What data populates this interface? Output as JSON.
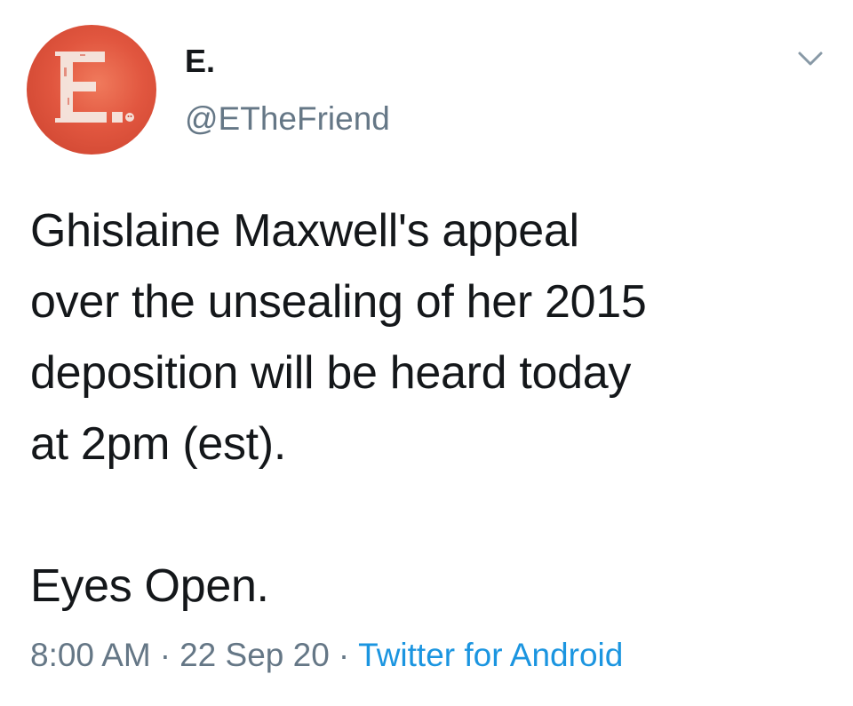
{
  "tweet": {
    "author": {
      "display_name": "E.",
      "handle": "@ETheFriend",
      "avatar_letter": "E."
    },
    "text": "Ghislaine Maxwell's appeal\nover the unsealing of her 2015\ndeposition will be heard today\nat 2pm (est).\n\nEyes Open.",
    "time": "8:00 AM",
    "separator": "·",
    "date": "22 Sep 20",
    "source": "Twitter for Android",
    "menu_icon": "chevron-down-icon",
    "colors": {
      "text": "#14171a",
      "secondary": "#657786",
      "link": "#1b95e0",
      "avatar_bg": "#e1563f"
    }
  }
}
